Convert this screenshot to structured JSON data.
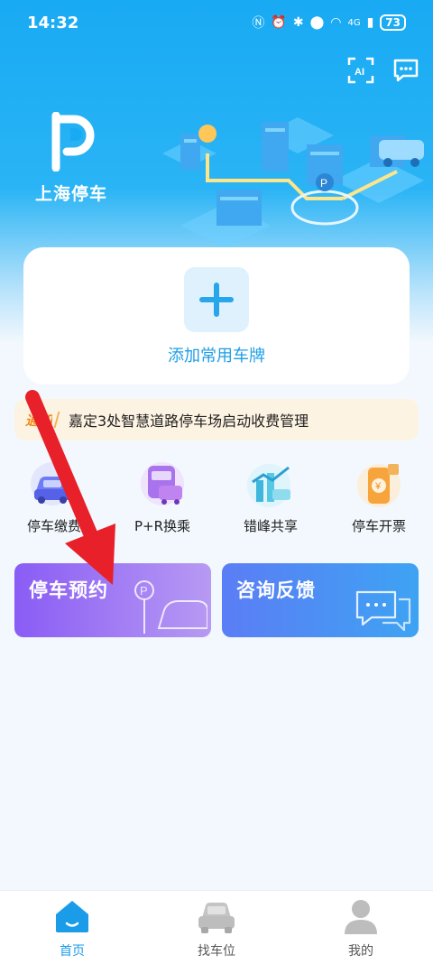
{
  "status_bar": {
    "time": "14:32",
    "battery": "73",
    "signal_label": "4G"
  },
  "header": {
    "logo_text": "上海停车",
    "ai_badge": "AI"
  },
  "plate_card": {
    "label": "添加常用车牌"
  },
  "notice": {
    "tag": "通知",
    "text": "嘉定3处智慧道路停车场启动收费管理"
  },
  "quick_actions": [
    {
      "label": "停车缴费",
      "icon": "car-payment-icon"
    },
    {
      "label": "P+R换乘",
      "icon": "bus-transfer-icon"
    },
    {
      "label": "错峰共享",
      "icon": "off-peak-share-icon"
    },
    {
      "label": "停车开票",
      "icon": "parking-invoice-icon"
    }
  ],
  "cards": {
    "reserve": "停车预约",
    "feedback": "咨询反馈"
  },
  "tabbar": [
    {
      "label": "首页",
      "icon": "home-icon",
      "active": true
    },
    {
      "label": "找车位",
      "icon": "car-icon",
      "active": false
    },
    {
      "label": "我的",
      "icon": "user-icon",
      "active": false
    }
  ],
  "colors": {
    "primary": "#1a9ce8",
    "hero_top": "#18aaf3",
    "reserve_start": "#8a5cf5",
    "feedback_start": "#5b7df5",
    "notice_bg": "#fdf3e2",
    "annotation_arrow": "#e8202a"
  }
}
